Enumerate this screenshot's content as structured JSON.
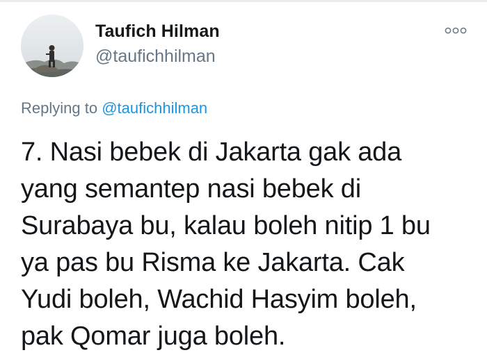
{
  "user": {
    "display_name": "Taufich Hilman",
    "handle": "@taufichhilman"
  },
  "icons": {
    "more": "more-options-icon",
    "avatar": "profile-photo"
  },
  "reply": {
    "prefix": "Replying to",
    "target": "@taufichhilman"
  },
  "tweet": {
    "text": "7. Nasi bebek di Jakarta gak ada\nyang semantep nasi bebek di\nSurabaya bu, kalau boleh nitip 1 bu\nya pas bu Risma ke Jakarta. Cak\nYudi boleh, Wachid Hasyim boleh,\npak Qomar juga boleh."
  },
  "colors": {
    "text": "#14171a",
    "secondary": "#657786",
    "link": "#1b95e0"
  }
}
